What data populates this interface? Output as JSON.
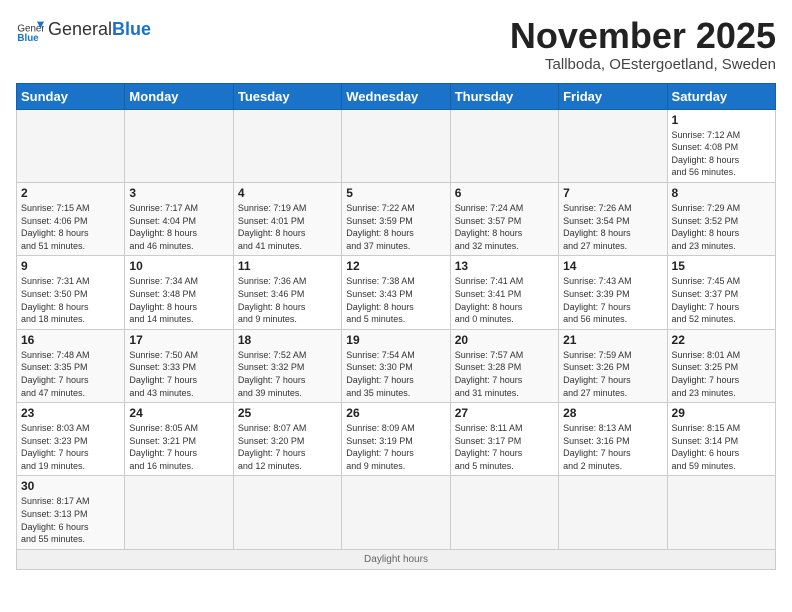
{
  "logo": {
    "general": "General",
    "blue": "Blue"
  },
  "header": {
    "month": "November 2025",
    "location": "Tallboda, OEstergoetland, Sweden"
  },
  "days_of_week": [
    "Sunday",
    "Monday",
    "Tuesday",
    "Wednesday",
    "Thursday",
    "Friday",
    "Saturday"
  ],
  "weeks": [
    [
      {
        "day": "",
        "info": ""
      },
      {
        "day": "",
        "info": ""
      },
      {
        "day": "",
        "info": ""
      },
      {
        "day": "",
        "info": ""
      },
      {
        "day": "",
        "info": ""
      },
      {
        "day": "",
        "info": ""
      },
      {
        "day": "1",
        "info": "Sunrise: 7:12 AM\nSunset: 4:08 PM\nDaylight: 8 hours\nand 56 minutes."
      }
    ],
    [
      {
        "day": "2",
        "info": "Sunrise: 7:15 AM\nSunset: 4:06 PM\nDaylight: 8 hours\nand 51 minutes."
      },
      {
        "day": "3",
        "info": "Sunrise: 7:17 AM\nSunset: 4:04 PM\nDaylight: 8 hours\nand 46 minutes."
      },
      {
        "day": "4",
        "info": "Sunrise: 7:19 AM\nSunset: 4:01 PM\nDaylight: 8 hours\nand 41 minutes."
      },
      {
        "day": "5",
        "info": "Sunrise: 7:22 AM\nSunset: 3:59 PM\nDaylight: 8 hours\nand 37 minutes."
      },
      {
        "day": "6",
        "info": "Sunrise: 7:24 AM\nSunset: 3:57 PM\nDaylight: 8 hours\nand 32 minutes."
      },
      {
        "day": "7",
        "info": "Sunrise: 7:26 AM\nSunset: 3:54 PM\nDaylight: 8 hours\nand 27 minutes."
      },
      {
        "day": "8",
        "info": "Sunrise: 7:29 AM\nSunset: 3:52 PM\nDaylight: 8 hours\nand 23 minutes."
      }
    ],
    [
      {
        "day": "9",
        "info": "Sunrise: 7:31 AM\nSunset: 3:50 PM\nDaylight: 8 hours\nand 18 minutes."
      },
      {
        "day": "10",
        "info": "Sunrise: 7:34 AM\nSunset: 3:48 PM\nDaylight: 8 hours\nand 14 minutes."
      },
      {
        "day": "11",
        "info": "Sunrise: 7:36 AM\nSunset: 3:46 PM\nDaylight: 8 hours\nand 9 minutes."
      },
      {
        "day": "12",
        "info": "Sunrise: 7:38 AM\nSunset: 3:43 PM\nDaylight: 8 hours\nand 5 minutes."
      },
      {
        "day": "13",
        "info": "Sunrise: 7:41 AM\nSunset: 3:41 PM\nDaylight: 8 hours\nand 0 minutes."
      },
      {
        "day": "14",
        "info": "Sunrise: 7:43 AM\nSunset: 3:39 PM\nDaylight: 7 hours\nand 56 minutes."
      },
      {
        "day": "15",
        "info": "Sunrise: 7:45 AM\nSunset: 3:37 PM\nDaylight: 7 hours\nand 52 minutes."
      }
    ],
    [
      {
        "day": "16",
        "info": "Sunrise: 7:48 AM\nSunset: 3:35 PM\nDaylight: 7 hours\nand 47 minutes."
      },
      {
        "day": "17",
        "info": "Sunrise: 7:50 AM\nSunset: 3:33 PM\nDaylight: 7 hours\nand 43 minutes."
      },
      {
        "day": "18",
        "info": "Sunrise: 7:52 AM\nSunset: 3:32 PM\nDaylight: 7 hours\nand 39 minutes."
      },
      {
        "day": "19",
        "info": "Sunrise: 7:54 AM\nSunset: 3:30 PM\nDaylight: 7 hours\nand 35 minutes."
      },
      {
        "day": "20",
        "info": "Sunrise: 7:57 AM\nSunset: 3:28 PM\nDaylight: 7 hours\nand 31 minutes."
      },
      {
        "day": "21",
        "info": "Sunrise: 7:59 AM\nSunset: 3:26 PM\nDaylight: 7 hours\nand 27 minutes."
      },
      {
        "day": "22",
        "info": "Sunrise: 8:01 AM\nSunset: 3:25 PM\nDaylight: 7 hours\nand 23 minutes."
      }
    ],
    [
      {
        "day": "23",
        "info": "Sunrise: 8:03 AM\nSunset: 3:23 PM\nDaylight: 7 hours\nand 19 minutes."
      },
      {
        "day": "24",
        "info": "Sunrise: 8:05 AM\nSunset: 3:21 PM\nDaylight: 7 hours\nand 16 minutes."
      },
      {
        "day": "25",
        "info": "Sunrise: 8:07 AM\nSunset: 3:20 PM\nDaylight: 7 hours\nand 12 minutes."
      },
      {
        "day": "26",
        "info": "Sunrise: 8:09 AM\nSunset: 3:19 PM\nDaylight: 7 hours\nand 9 minutes."
      },
      {
        "day": "27",
        "info": "Sunrise: 8:11 AM\nSunset: 3:17 PM\nDaylight: 7 hours\nand 5 minutes."
      },
      {
        "day": "28",
        "info": "Sunrise: 8:13 AM\nSunset: 3:16 PM\nDaylight: 7 hours\nand 2 minutes."
      },
      {
        "day": "29",
        "info": "Sunrise: 8:15 AM\nSunset: 3:14 PM\nDaylight: 6 hours\nand 59 minutes."
      }
    ],
    [
      {
        "day": "30",
        "info": "Sunrise: 8:17 AM\nSunset: 3:13 PM\nDaylight: 6 hours\nand 55 minutes."
      },
      {
        "day": "",
        "info": ""
      },
      {
        "day": "",
        "info": ""
      },
      {
        "day": "",
        "info": ""
      },
      {
        "day": "",
        "info": ""
      },
      {
        "day": "",
        "info": ""
      },
      {
        "day": "",
        "info": ""
      }
    ]
  ],
  "footer": {
    "text": "Daylight hours"
  }
}
